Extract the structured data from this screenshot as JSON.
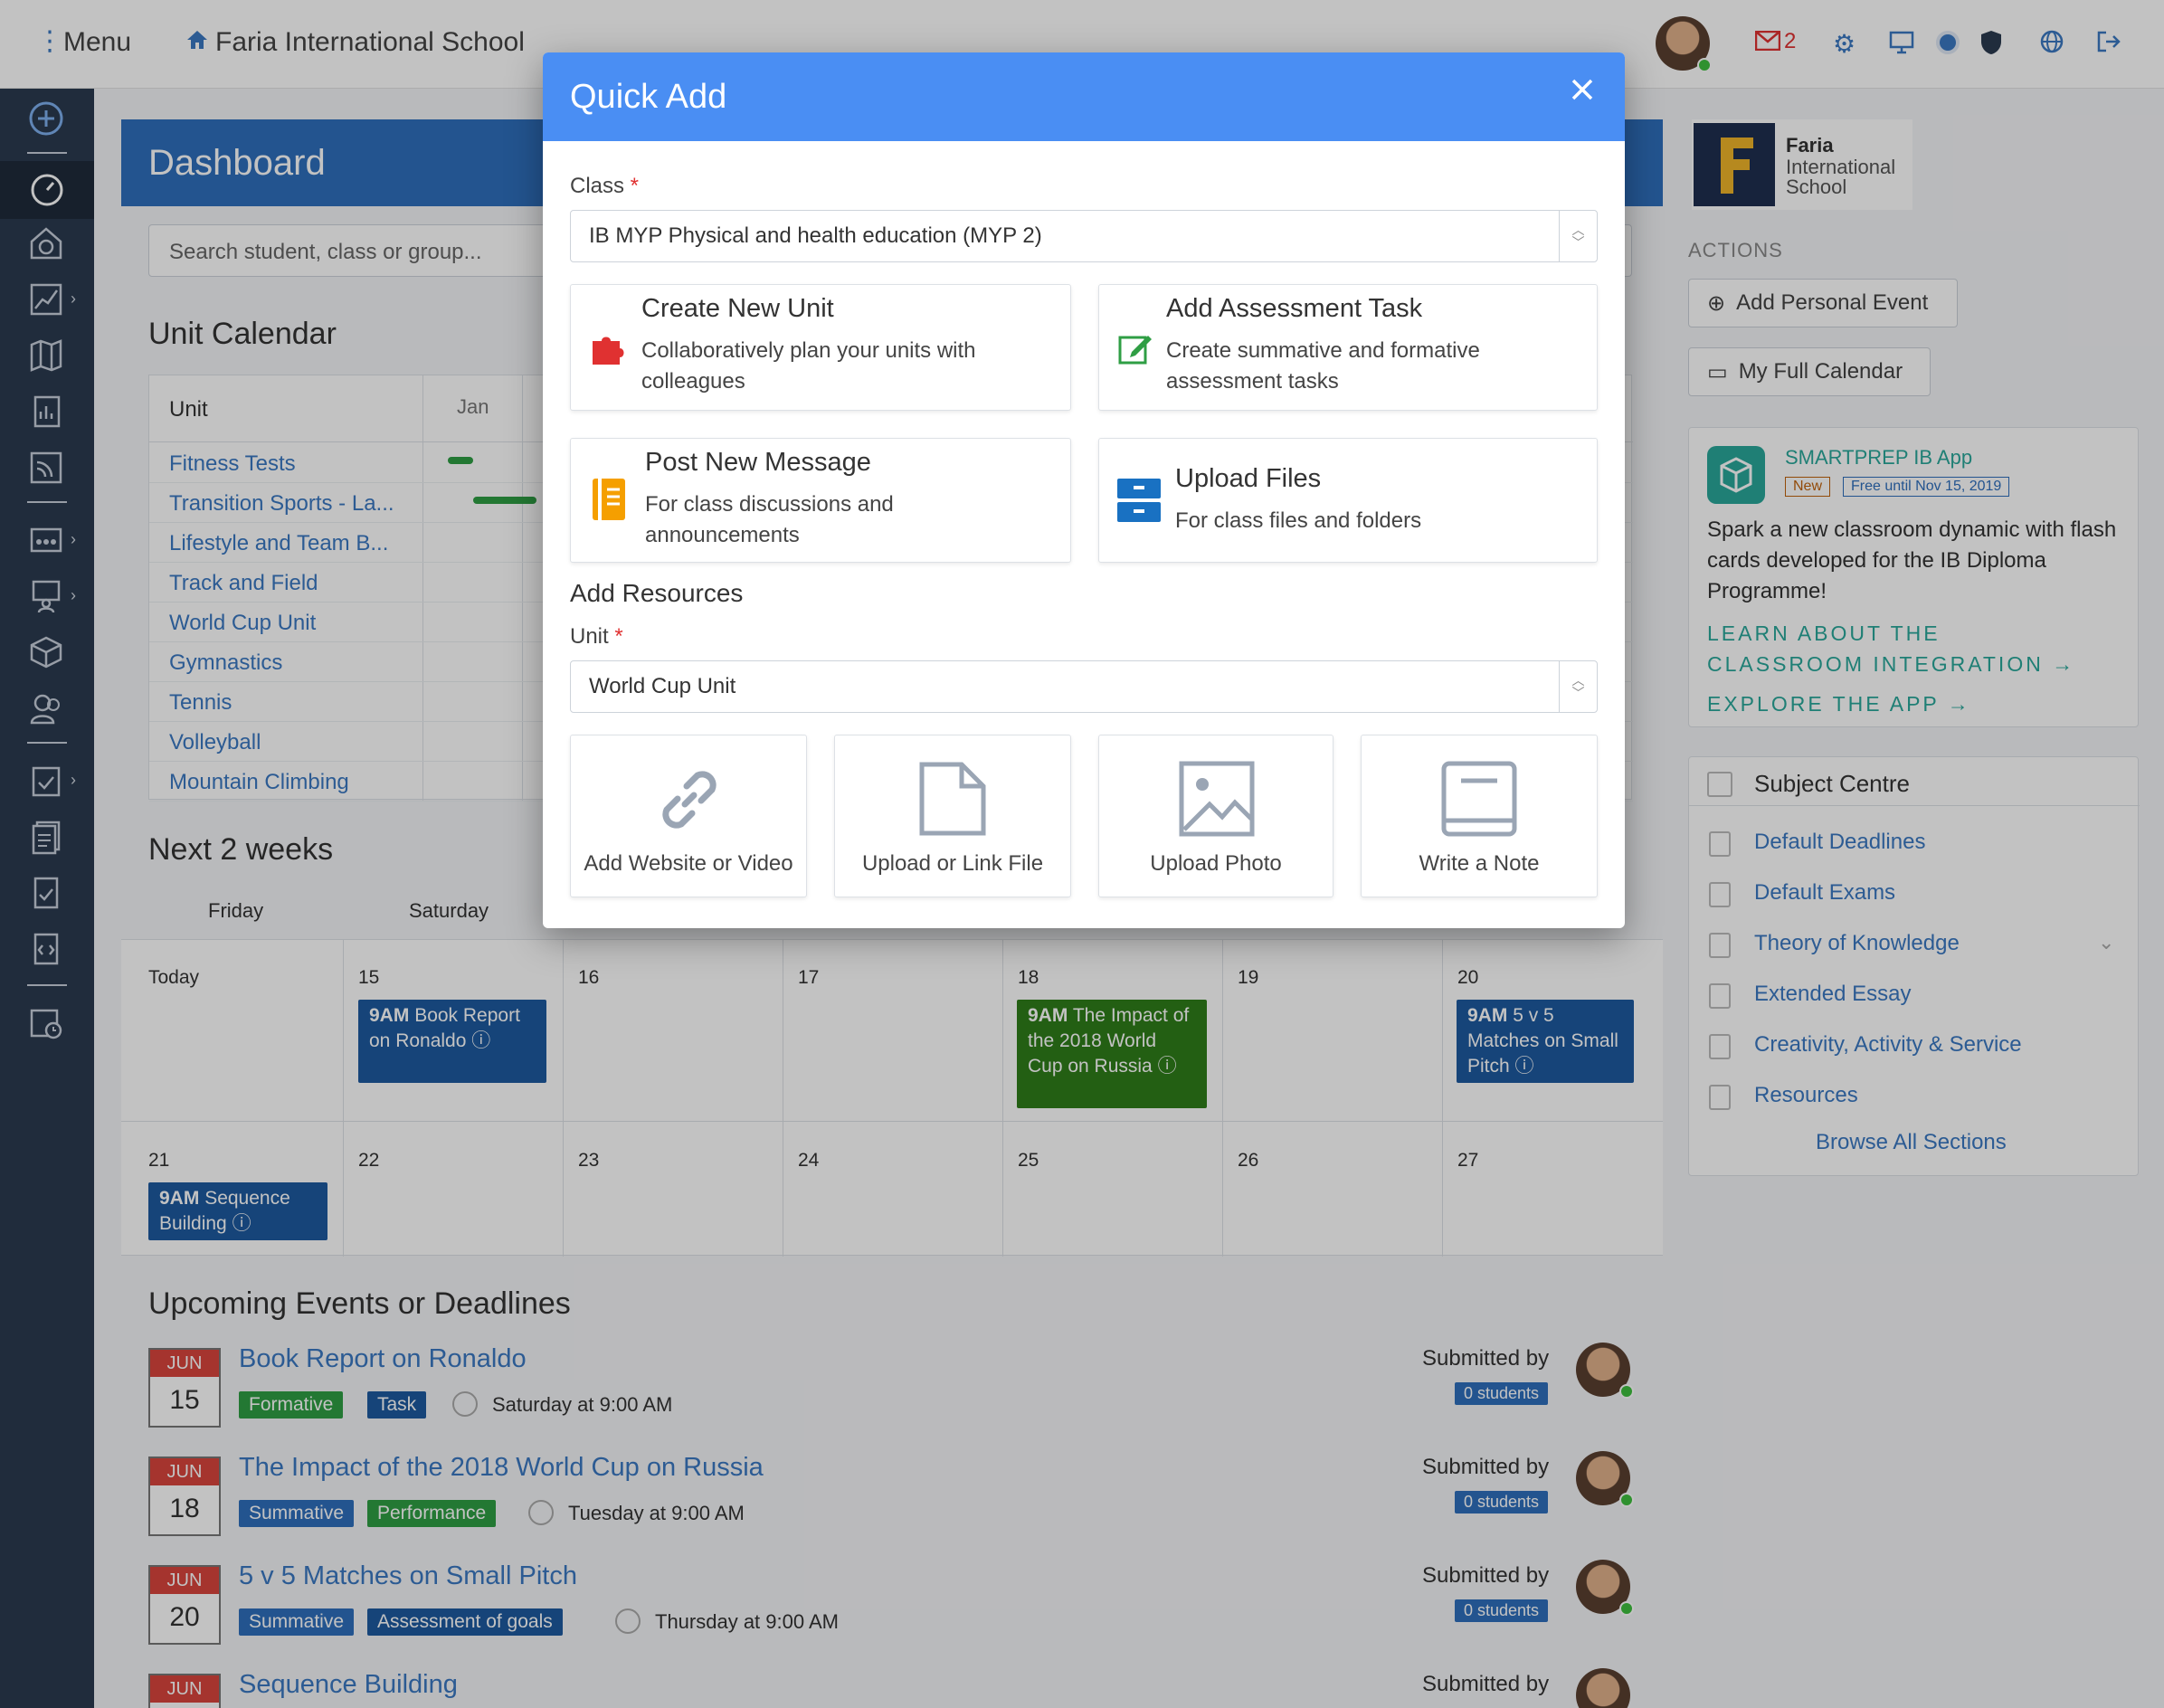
{
  "topbar": {
    "menu_label": "Menu",
    "school_name": "Faria International School",
    "mail_count": "2"
  },
  "dashboard": {
    "title": "Dashboard",
    "search_placeholder": "Search student, class or group..."
  },
  "unit_calendar": {
    "title": "Unit Calendar",
    "col_unit": "Unit",
    "col_month": "Jan",
    "units": [
      "Fitness Tests",
      "Transition Sports - La...",
      "Lifestyle and Team B...",
      "Track and Field",
      "World Cup Unit",
      "Gymnastics",
      "Tennis",
      "Volleyball",
      "Mountain Climbing"
    ]
  },
  "next_weeks": {
    "title": "Next 2 weeks",
    "day_headers": [
      "Friday",
      "Saturday"
    ],
    "week1": [
      "Today",
      "15",
      "16",
      "17",
      "18",
      "19",
      "20"
    ],
    "week2": [
      "21",
      "22",
      "23",
      "24",
      "25",
      "26",
      "27"
    ],
    "events": [
      {
        "time": "9AM",
        "text": "Book Report on Ronaldo",
        "color": "#1d5aa0"
      },
      {
        "time": "9AM",
        "text": "The Impact of the 2018 World Cup on Russia",
        "color": "#2f7d1a"
      },
      {
        "time": "9AM",
        "text": "5 v 5 Matches on Small Pitch",
        "color": "#1d5aa0"
      },
      {
        "time": "9AM",
        "text": "Sequence Building",
        "color": "#1d5aa0"
      }
    ]
  },
  "upcoming": {
    "title": "Upcoming Events or Deadlines",
    "submitted_label": "Submitted by",
    "items": [
      {
        "month": "JUN",
        "day": "15",
        "title": "Book Report on Ronaldo",
        "tags": [
          "Formative",
          "Task"
        ],
        "when": "Saturday at 9:00 AM",
        "students": "0 students"
      },
      {
        "month": "JUN",
        "day": "18",
        "title": "The Impact of the 2018 World Cup on Russia",
        "tags": [
          "Summative",
          "Performance"
        ],
        "when": "Tuesday at 9:00 AM",
        "students": "0 students"
      },
      {
        "month": "JUN",
        "day": "20",
        "title": "5 v 5 Matches on Small Pitch",
        "tags": [
          "Summative",
          "Assessment of goals"
        ],
        "when": "Thursday at 9:00 AM",
        "students": "0 students"
      },
      {
        "month": "JUN",
        "title": "Sequence Building"
      }
    ]
  },
  "right": {
    "logo_line1": "Faria",
    "logo_line2": "International",
    "logo_line3": "School",
    "actions_label": "ACTIONS",
    "add_personal_event": "Add Personal Event",
    "my_full_calendar": "My Full Calendar",
    "smartprep": {
      "brand": "SMARTPREP",
      "app": "IB App",
      "new_badge": "New",
      "free_badge": "Free until Nov 15, 2019",
      "body": "Spark a new classroom dynamic with flash cards developed for the IB Diploma Programme!",
      "learn_line1": "LEARN ABOUT THE",
      "learn_line2": "CLASSROOM INTEGRATION →",
      "explore": "EXPLORE THE APP →"
    },
    "subject_centre": {
      "title": "Subject Centre",
      "items": [
        "Default Deadlines",
        "Default Exams",
        "Theory of Knowledge",
        "Extended Essay",
        "Creativity, Activity & Service",
        "Resources"
      ],
      "browse": "Browse All Sections"
    }
  },
  "modal": {
    "title": "Quick Add",
    "class_label": "Class",
    "class_value": "IB MYP Physical and health education (MYP 2)",
    "cards": [
      {
        "title": "Create New Unit",
        "desc": "Collaboratively plan your units with colleagues"
      },
      {
        "title": "Add Assessment Task",
        "desc": "Create summative and formative assessment tasks"
      },
      {
        "title": "Post New Message",
        "desc": "For class discussions and announcements"
      },
      {
        "title": "Upload Files",
        "desc": "For class files and folders"
      }
    ],
    "resources_title": "Add Resources",
    "unit_label": "Unit",
    "unit_value": "World Cup Unit",
    "resources": [
      "Add Website or Video",
      "Upload or Link File",
      "Upload Photo",
      "Write a Note"
    ]
  },
  "colors": {
    "primary": "#4a8ef3",
    "sidebar": "#2b3a4f",
    "formative": "#2f9e44",
    "summative": "#2f6fbd",
    "required": "#e03131",
    "teal": "#2aa89a"
  }
}
